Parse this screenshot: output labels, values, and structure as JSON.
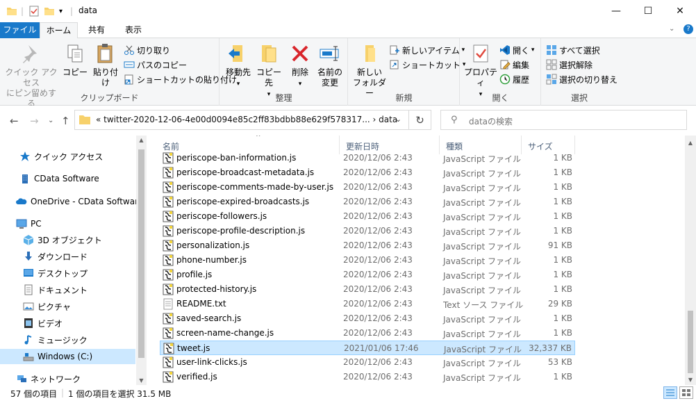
{
  "window": {
    "title": "data",
    "minimize": "—",
    "maximize": "☐",
    "close": "✕"
  },
  "tabs": {
    "file": "ファイル",
    "home": "ホーム",
    "share": "共有",
    "view": "表示"
  },
  "ribbon": {
    "clipboard": {
      "label": "クリップボード",
      "pin_quick_access_1": "クイック アクセス",
      "pin_quick_access_2": "にピン留めする",
      "copy": "コピー",
      "paste": "貼り付け",
      "cut": "切り取り",
      "copy_path": "パスのコピー",
      "paste_shortcut": "ショートカットの貼り付け"
    },
    "organize": {
      "label": "整理",
      "move_to": "移動先",
      "copy_to": "コピー先",
      "delete": "削除",
      "rename_1": "名前の",
      "rename_2": "変更"
    },
    "new": {
      "label": "新規",
      "new_folder_1": "新しい",
      "new_folder_2": "フォルダー",
      "new_item": "新しいアイテム",
      "easy_access": "ショートカット"
    },
    "open": {
      "label": "開く",
      "properties": "プロパティ",
      "open": "開く",
      "edit": "編集",
      "history": "履歴"
    },
    "select": {
      "label": "選択",
      "select_all": "すべて選択",
      "select_none": "選択解除",
      "invert": "選択の切り替え"
    }
  },
  "address": {
    "path": "«   twitter-2020-12-06-4e00d0094e85c2ff83bdbb88e629f578317...   ›   data",
    "search_placeholder": "dataの検索"
  },
  "nav_pane": {
    "items": [
      {
        "label": "クイック アクセス",
        "icon": "star-icon"
      },
      {
        "label": "CData Software",
        "icon": "building-icon"
      },
      {
        "label": "OneDrive - CData Software",
        "icon": "cloud-icon"
      },
      {
        "label": "PC",
        "icon": "pc-icon"
      },
      {
        "label": "3D オブジェクト",
        "icon": "cube-icon"
      },
      {
        "label": "ダウンロード",
        "icon": "download-icon"
      },
      {
        "label": "デスクトップ",
        "icon": "desktop-icon"
      },
      {
        "label": "ドキュメント",
        "icon": "document-icon"
      },
      {
        "label": "ピクチャ",
        "icon": "picture-icon"
      },
      {
        "label": "ビデオ",
        "icon": "video-icon"
      },
      {
        "label": "ミュージック",
        "icon": "music-icon"
      },
      {
        "label": "Windows (C:)",
        "icon": "drive-icon"
      },
      {
        "label": "ネットワーク",
        "icon": "network-icon"
      }
    ]
  },
  "columns": {
    "name": "名前",
    "date": "更新日時",
    "type": "種類",
    "size": "サイズ"
  },
  "files": [
    {
      "name": "periscope-ban-information.js",
      "date": "2020/12/06 2:43",
      "type": "JavaScript ファイル",
      "size": "1 KB",
      "icon": "js-file-icon"
    },
    {
      "name": "periscope-broadcast-metadata.js",
      "date": "2020/12/06 2:43",
      "type": "JavaScript ファイル",
      "size": "1 KB",
      "icon": "js-file-icon"
    },
    {
      "name": "periscope-comments-made-by-user.js",
      "date": "2020/12/06 2:43",
      "type": "JavaScript ファイル",
      "size": "1 KB",
      "icon": "js-file-icon"
    },
    {
      "name": "periscope-expired-broadcasts.js",
      "date": "2020/12/06 2:43",
      "type": "JavaScript ファイル",
      "size": "1 KB",
      "icon": "js-file-icon"
    },
    {
      "name": "periscope-followers.js",
      "date": "2020/12/06 2:43",
      "type": "JavaScript ファイル",
      "size": "1 KB",
      "icon": "js-file-icon"
    },
    {
      "name": "periscope-profile-description.js",
      "date": "2020/12/06 2:43",
      "type": "JavaScript ファイル",
      "size": "1 KB",
      "icon": "js-file-icon"
    },
    {
      "name": "personalization.js",
      "date": "2020/12/06 2:43",
      "type": "JavaScript ファイル",
      "size": "91 KB",
      "icon": "js-file-icon"
    },
    {
      "name": "phone-number.js",
      "date": "2020/12/06 2:43",
      "type": "JavaScript ファイル",
      "size": "1 KB",
      "icon": "js-file-icon"
    },
    {
      "name": "profile.js",
      "date": "2020/12/06 2:43",
      "type": "JavaScript ファイル",
      "size": "1 KB",
      "icon": "js-file-icon"
    },
    {
      "name": "protected-history.js",
      "date": "2020/12/06 2:43",
      "type": "JavaScript ファイル",
      "size": "1 KB",
      "icon": "js-file-icon"
    },
    {
      "name": "README.txt",
      "date": "2020/12/06 2:43",
      "type": "Text ソース ファイル",
      "size": "29 KB",
      "icon": "text-file-icon"
    },
    {
      "name": "saved-search.js",
      "date": "2020/12/06 2:43",
      "type": "JavaScript ファイル",
      "size": "1 KB",
      "icon": "js-file-icon"
    },
    {
      "name": "screen-name-change.js",
      "date": "2020/12/06 2:43",
      "type": "JavaScript ファイル",
      "size": "1 KB",
      "icon": "js-file-icon"
    },
    {
      "name": "tweet.js",
      "date": "2021/01/06 17:46",
      "type": "JavaScript ファイル",
      "size": "32,337 KB",
      "icon": "js-file-icon",
      "selected": true
    },
    {
      "name": "user-link-clicks.js",
      "date": "2020/12/06 2:43",
      "type": "JavaScript ファイル",
      "size": "53 KB",
      "icon": "js-file-icon"
    },
    {
      "name": "verified.js",
      "date": "2020/12/06 2:43",
      "type": "JavaScript ファイル",
      "size": "1 KB",
      "icon": "js-file-icon"
    }
  ],
  "status": {
    "item_count": "57 個の項目",
    "selection": "1 個の項目を選択  31.5 MB"
  },
  "colors": {
    "accent": "#1979ca",
    "selection": "#cce8ff",
    "selection_border": "#99d1ff"
  }
}
